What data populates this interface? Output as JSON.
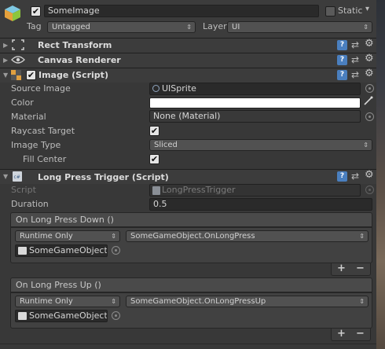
{
  "header": {
    "object_name": "SomeImage",
    "static_label": "Static",
    "tag_label": "Tag",
    "tag_value": "Untagged",
    "layer_label": "Layer",
    "layer_value": "UI"
  },
  "components": {
    "rect_transform": {
      "title": "Rect Transform"
    },
    "canvas_renderer": {
      "title": "Canvas Renderer"
    },
    "image": {
      "title": "Image (Script)",
      "source_image_label": "Source Image",
      "source_image_value": "UISprite",
      "color_label": "Color",
      "color_value": "#ffffff",
      "material_label": "Material",
      "material_value": "None (Material)",
      "raycast_label": "Raycast Target",
      "raycast_checked": "✔",
      "image_type_label": "Image Type",
      "image_type_value": "Sliced",
      "fill_center_label": "Fill Center",
      "fill_center_checked": "✔"
    },
    "long_press": {
      "title": "Long Press Trigger (Script)",
      "script_label": "Script",
      "script_value": "LongPressTrigger",
      "duration_label": "Duration",
      "duration_value": "0.5",
      "events": [
        {
          "title": "On Long Press Down ()",
          "mode": "Runtime Only",
          "function": "SomeGameObject.OnLongPress",
          "target": "SomeGameObject ("
        },
        {
          "title": "On Long Press Up ()",
          "mode": "Runtime Only",
          "function": "SomeGameObject.OnLongPressUp",
          "target": "SomeGameObject ("
        }
      ],
      "add_label": "+",
      "remove_label": "−"
    }
  },
  "icons": {
    "help": "?",
    "dropdown_arrow": "▾",
    "popup_arrow": "⇕",
    "fold_open": "▼",
    "fold_closed": "▶",
    "gear": "⚙",
    "preset": "⇄",
    "eyedropper": "⁄",
    "checkmark": "✔"
  },
  "colors": {
    "help_icon": "#4a7fbf",
    "panel_bg": "#383838"
  }
}
